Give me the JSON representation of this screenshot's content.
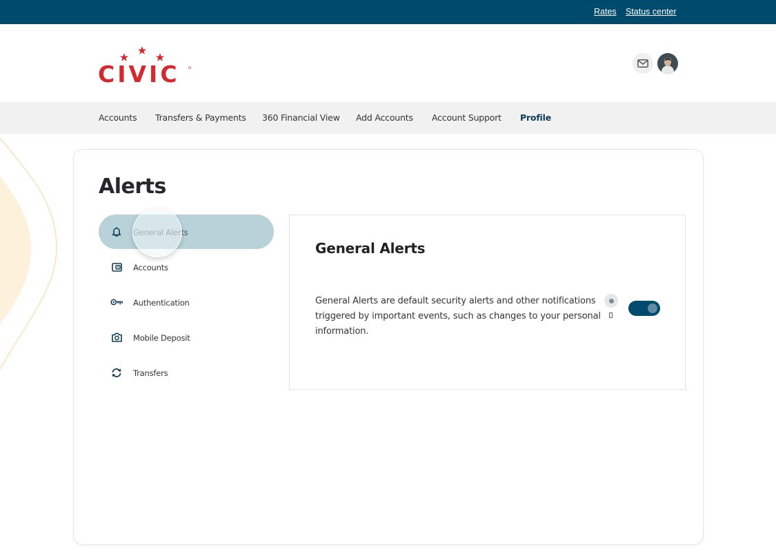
{
  "utility_bar": {
    "links": [
      {
        "label": "Rates"
      },
      {
        "label": "Status center"
      }
    ]
  },
  "header": {
    "logo_text": "CIVIC",
    "icons": {
      "mail": "mail-icon",
      "avatar": "user-avatar"
    }
  },
  "nav": {
    "items": [
      {
        "label": "Accounts",
        "active": false
      },
      {
        "label": "Transfers & Payments",
        "active": false
      },
      {
        "label": "360 Financial View",
        "active": false
      },
      {
        "label": "Add Accounts",
        "active": false
      },
      {
        "label": "Account Support",
        "active": false
      },
      {
        "label": "Profile",
        "active": true
      }
    ]
  },
  "page": {
    "title": "Alerts"
  },
  "sidebar": {
    "items": [
      {
        "label": "General Alerts",
        "icon": "bell-icon",
        "active": true
      },
      {
        "label": "Accounts",
        "icon": "wallet-icon",
        "active": false
      },
      {
        "label": "Authentication",
        "icon": "key-icon",
        "active": false
      },
      {
        "label": "Mobile Deposit",
        "icon": "camera-icon",
        "active": false
      },
      {
        "label": "Transfers",
        "icon": "transfer-arrows-icon",
        "active": false
      }
    ]
  },
  "panel": {
    "title": "General Alerts",
    "description": "General Alerts are default security alerts and other notifications triggered by important events, such as changes to your personal information.",
    "channels": [
      "email",
      "mobile"
    ],
    "toggle_on": true
  },
  "colors": {
    "brand_dark": "#004a6e",
    "brand_red": "#d7282f",
    "active_sidebar": "#b9d2da",
    "nav_background": "#f1f1f1"
  }
}
